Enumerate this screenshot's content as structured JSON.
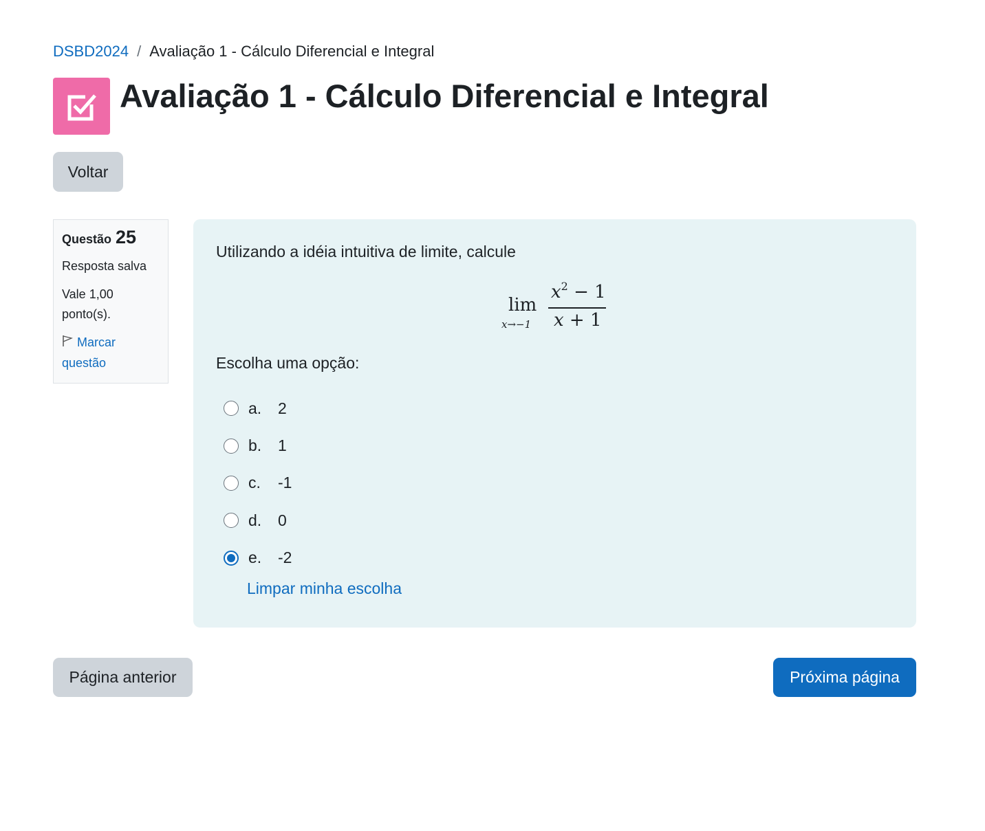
{
  "breadcrumb": {
    "course": "DSBD2024",
    "separator": "/",
    "current": "Avaliação 1 - Cálculo Diferencial e Integral"
  },
  "header": {
    "icon": "quiz-checkbox-icon",
    "icon_color": "#ef6ba8",
    "title": "Avaliação 1 - Cálculo Diferencial e Integral"
  },
  "back_button": "Voltar",
  "question_info": {
    "label": "Questão",
    "number": "25",
    "status": "Resposta salva",
    "points": "Vale 1,00 ponto(s).",
    "flag_label": "Marcar questão"
  },
  "question": {
    "text": "Utilizando a idéia intuitiva de limite, calcule",
    "formula": {
      "lim": "lim",
      "subscript": "x→−1",
      "numerator_base": "x",
      "numerator_exp": "2",
      "numerator_rest": " − 1",
      "denominator_var": "x",
      "denominator_rest": " + 1"
    },
    "prompt": "Escolha uma opção:",
    "options": [
      {
        "letter": "a.",
        "value": "2",
        "selected": false
      },
      {
        "letter": "b.",
        "value": "1",
        "selected": false
      },
      {
        "letter": "c.",
        "value": "-1",
        "selected": false
      },
      {
        "letter": "d.",
        "value": "0",
        "selected": false
      },
      {
        "letter": "e.",
        "value": "-2",
        "selected": true
      }
    ],
    "clear_link": "Limpar minha escolha"
  },
  "navigation": {
    "prev": "Página anterior",
    "next": "Próxima página"
  },
  "colors": {
    "accent": "#0f6cbf",
    "content_background": "#e7f3f5",
    "secondary_button": "#ced4da"
  }
}
